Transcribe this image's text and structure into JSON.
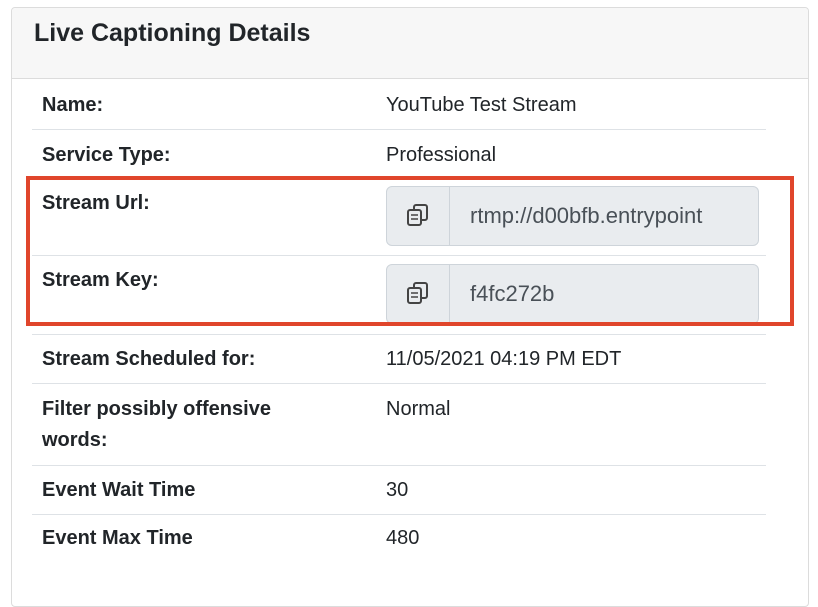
{
  "panel": {
    "title": "Live Captioning Details"
  },
  "details": {
    "name_label": "Name:",
    "name_value": "YouTube Test Stream",
    "service_type_label": "Service Type:",
    "service_type_value": "Professional",
    "stream_url_label": "Stream Url:",
    "stream_url_value": "rtmp://d00bfb.entrypoint",
    "stream_key_label": "Stream Key:",
    "stream_key_value": "f4fc272b",
    "scheduled_label": "Stream Scheduled for:",
    "scheduled_value": "11/05/2021 04:19 PM EDT",
    "filter_label": "Filter possibly offensive words:",
    "filter_value": "Normal",
    "wait_time_label": "Event Wait Time",
    "wait_time_value": "30",
    "max_time_label": "Event Max Time",
    "max_time_value": "480"
  },
  "icons": {
    "copy": "copy-icon"
  },
  "colors": {
    "highlight": "#e0452b",
    "header_bg": "#f7f7f7",
    "field_bg": "#e9ecef"
  }
}
